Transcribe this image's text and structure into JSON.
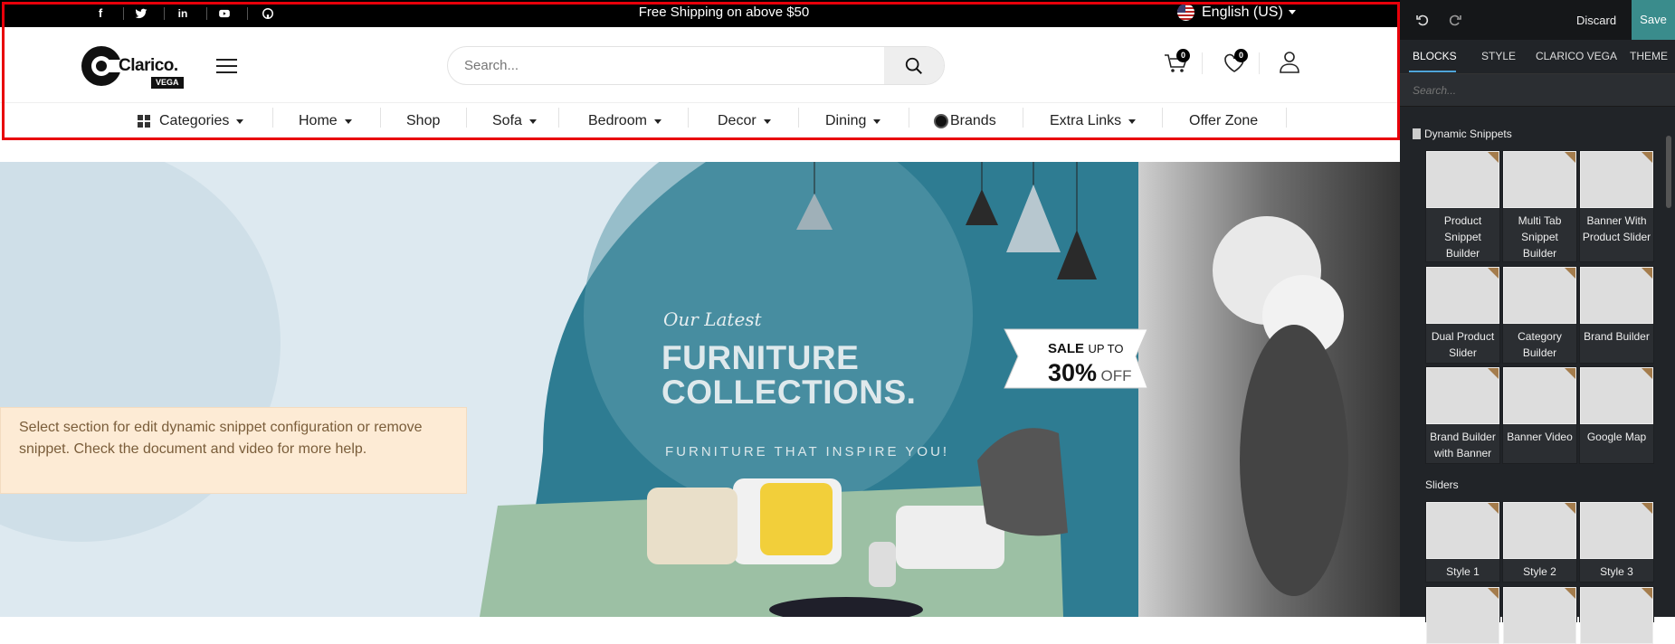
{
  "topbar": {
    "social": [
      "facebook-icon",
      "twitter-icon",
      "linkedin-icon",
      "youtube-icon",
      "github-icon"
    ],
    "shipping_text": "Free Shipping on above $50",
    "language": "English (US)"
  },
  "header": {
    "logo_text": "Clarico.",
    "logo_sub": "VEGA",
    "search_placeholder": "Search...",
    "cart_count": "0",
    "wishlist_count": "0"
  },
  "nav": {
    "items": [
      {
        "label": "Categories",
        "dropdown": true
      },
      {
        "label": "Home",
        "dropdown": true
      },
      {
        "label": "Shop",
        "dropdown": false
      },
      {
        "label": "Sofa",
        "dropdown": true
      },
      {
        "label": "Bedroom",
        "dropdown": true
      },
      {
        "label": "Decor",
        "dropdown": true
      },
      {
        "label": "Dining",
        "dropdown": true
      },
      {
        "label": "Brands",
        "dropdown": false
      },
      {
        "label": "Extra Links",
        "dropdown": true
      },
      {
        "label": "Offer Zone",
        "dropdown": false
      }
    ]
  },
  "hero": {
    "script_text": "Our Latest",
    "title_line1": "FURNITURE",
    "title_line2": "COLLECTIONS.",
    "tagline": "FURNITURE THAT INSPIRE YOU!",
    "sale_word": "SALE",
    "sale_upto": "UP TO",
    "sale_pct": "30%",
    "sale_off": "OFF"
  },
  "notice": "Select section for edit dynamic snippet configuration or remove snippet. Check the document and video for more help.",
  "editor": {
    "discard": "Discard",
    "save": "Save",
    "tabs": [
      "BLOCKS",
      "STYLE",
      "CLARICO VEGA",
      "THEME"
    ],
    "search_placeholder": "Search...",
    "section_dynamic": "Dynamic Snippets",
    "section_sliders": "Sliders",
    "dynamic_items": [
      "Product Snippet Builder",
      "Multi Tab Snippet Builder",
      "Banner With Product Slider",
      "Dual Product Slider",
      "Category Builder",
      "Brand Builder",
      "Brand Builder with Banner",
      "Banner Video",
      "Google Map"
    ],
    "slider_items": [
      "Style 1",
      "Style 2",
      "Style 3"
    ]
  },
  "colors": {
    "selection": "#e8000a",
    "save": "#3a8c8c",
    "accent_tab": "#4fa4d8",
    "hero_teal": "#2e7c92"
  }
}
